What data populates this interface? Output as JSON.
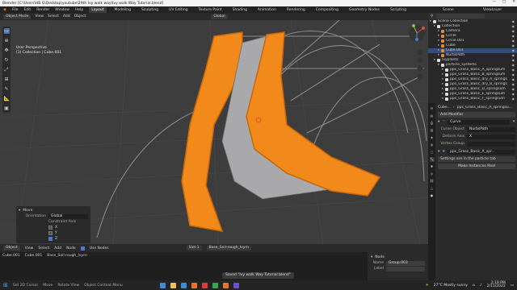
{
  "window": {
    "title": "Blender [C:\\Users\\HB G\\Desktop\\youtube\\29th Ivy walk way\\Ivy walk Way Tutorial.blend]",
    "controls": [
      "—",
      "□",
      "✕"
    ]
  },
  "menubar": {
    "menus": [
      "File",
      "Edit",
      "Render",
      "Window",
      "Help"
    ],
    "workspaces": [
      "Layout",
      "Modeling",
      "Sculpting",
      "UV Editing",
      "Texture Paint",
      "Shading",
      "Animation",
      "Rendering",
      "Compositing",
      "Geometry Nodes",
      "Scripting"
    ],
    "active_workspace": "Layout",
    "scene": "Scene",
    "view_layer": "ViewLayer"
  },
  "viewport": {
    "mode": "Object Mode",
    "menus": [
      "View",
      "Select",
      "Add",
      "Object"
    ],
    "orientation": "Global",
    "options_label": "Options",
    "info_line1": "User Perspective",
    "info_line2": "(1) Collection | Cube.001"
  },
  "redo_panel": {
    "title": "Move",
    "orientation_label": "Orientation",
    "orientation_value": "Global",
    "constraint_label": "Constraint Axis",
    "axes": [
      {
        "label": "X",
        "checked": false
      },
      {
        "label": "Y",
        "checked": false
      },
      {
        "label": "Z",
        "checked": true
      }
    ]
  },
  "node_editor": {
    "header_mode": "Object",
    "menus": [
      "View",
      "Select",
      "Add",
      "Node"
    ],
    "use_nodes_label": "Use Nodes",
    "slot": "Slot 1",
    "material": "Base_Soil-rough_Ivyrn",
    "breadcrumb": [
      "Cube.001",
      "Cube.001",
      "Base_Soil-rough_Ivyrn"
    ],
    "panel_title": "Node",
    "name_label": "Name",
    "name_value": "Group.003",
    "label_label": "Label"
  },
  "outliner": {
    "items": [
      {
        "label": "Scene Collection",
        "indent": 0,
        "color": "#dddddd",
        "selected": false
      },
      {
        "label": "Collection",
        "indent": 1,
        "color": "#dddddd",
        "selected": false
      },
      {
        "label": "Camera",
        "indent": 2,
        "color": "#e08a3c",
        "selected": false
      },
      {
        "label": "Circle",
        "indent": 2,
        "color": "#e08a3c",
        "selected": false
      },
      {
        "label": "Circle.001",
        "indent": 2,
        "color": "#e08a3c",
        "selected": false
      },
      {
        "label": "Cube",
        "indent": 2,
        "color": "#e08a3c",
        "selected": false
      },
      {
        "label": "Cube.001",
        "indent": 2,
        "color": "#e08a3c",
        "selected": true
      },
      {
        "label": "NurbsPath",
        "indent": 2,
        "color": "#e08a3c",
        "selected": false
      },
      {
        "label": "Ivyplants",
        "indent": 1,
        "color": "#dddddd",
        "selected": false
      },
      {
        "label": "particle_systems",
        "indent": 2,
        "color": "#dddddd",
        "selected": false
      },
      {
        "label": "pps_Grass_Basic_A_springsum",
        "indent": 3,
        "color": "#dddddd",
        "selected": false
      },
      {
        "label": "pps_Grass_Basic_B_springsum",
        "indent": 3,
        "color": "#dddddd",
        "selected": false
      },
      {
        "label": "pps_Grass_Basic_dry_A_springs",
        "indent": 3,
        "color": "#dddddd",
        "selected": false
      },
      {
        "label": "pps_Grass_Basic_dry_B_springs",
        "indent": 3,
        "color": "#dddddd",
        "selected": false
      },
      {
        "label": "pps_Grass_Basic_D_springsum",
        "indent": 3,
        "color": "#dddddd",
        "selected": false
      },
      {
        "label": "pps_Grass_Basic_E_springsum",
        "indent": 3,
        "color": "#dddddd",
        "selected": false
      },
      {
        "label": "pps_Grass_Basic_F_springsum",
        "indent": 3,
        "color": "#dddddd",
        "selected": false
      }
    ]
  },
  "properties": {
    "object_path": "Cube...",
    "object_path2": "pps_Grass_Basic_A_springsu...",
    "add_modifier": "Add Modifier",
    "modifier_name": "Curve",
    "fields": [
      {
        "label": "Curve Object",
        "value": "NurbsPath"
      },
      {
        "label": "Deform Axis",
        "value": "X"
      },
      {
        "label": "Vertex Group",
        "value": ""
      }
    ],
    "ps_name": "pps_Grass_Basic_A_spr...",
    "settings_msg": "Settings are in the particle tab",
    "make_real": "Make Instances Real"
  },
  "statusbar": {
    "items": [
      "Set 3D Cursor",
      "Move",
      "Rotate View",
      "Object Context Menu"
    ],
    "saved_msg": "Saved \"Ivy walk Way Tutorial.blend\""
  },
  "taskbar": {
    "weather": "27°C  Mostly sunny",
    "time": "3:19 PM",
    "date": "2/11/2022"
  },
  "colors": {
    "accent_blue": "#4a6fa5",
    "ivy_orange": "#f28a1b",
    "selection_orange": "#e08a3c"
  }
}
